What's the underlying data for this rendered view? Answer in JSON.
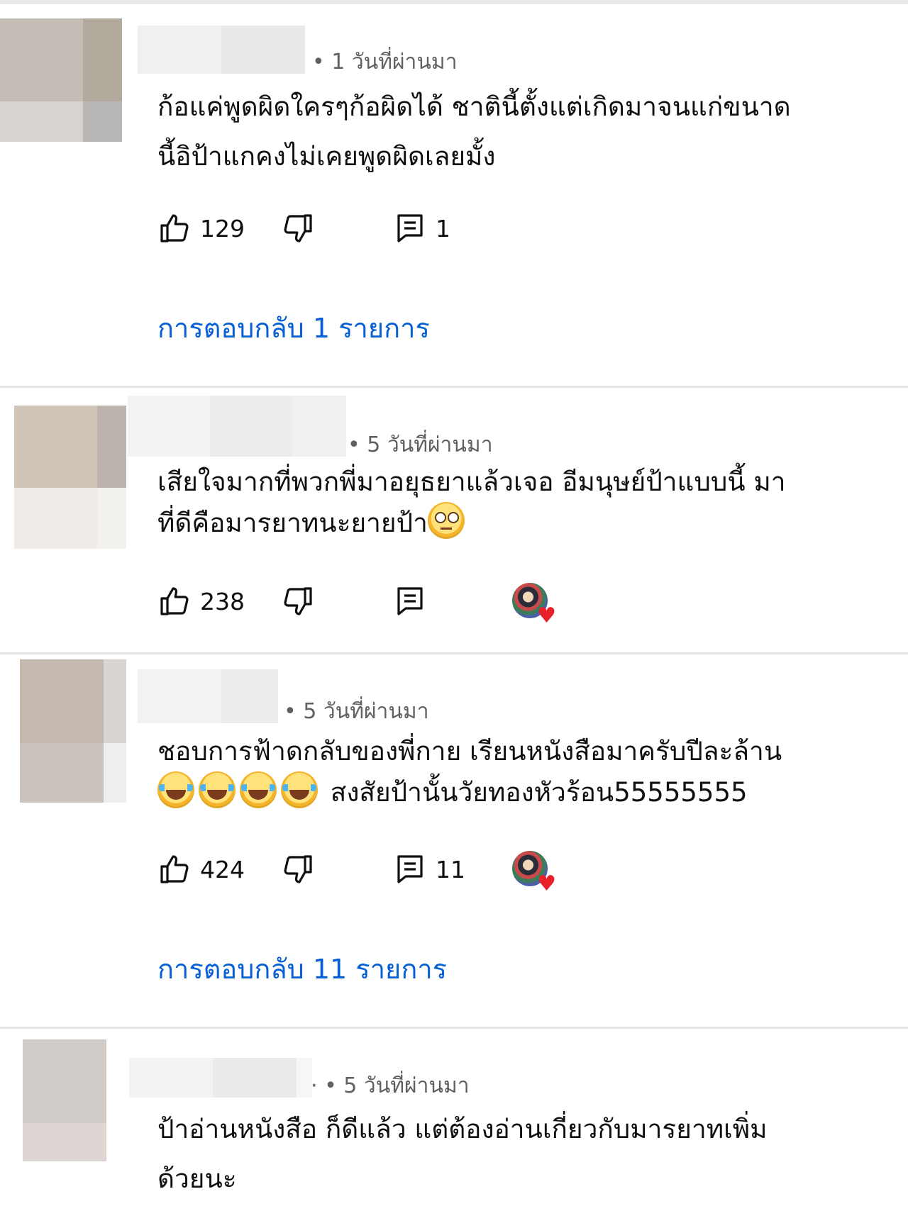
{
  "comments": [
    {
      "time": "• 1 วันที่ผ่านมา",
      "text_lines": [
        "ก้อแค่พูดผิดใครๆก้อผิดได้ ชาตินี้ตั้งแต่เกิดมาจนแก่ขนาด",
        "นี้อิป้าแกคงไม่เคยพูดผิดเลยมั้ง"
      ],
      "likes": "129",
      "reply_count": "1",
      "replies_link": "การตอบกลับ 1 รายการ"
    },
    {
      "time": "• 5 วันที่ผ่านมา",
      "text_lines": [
        "เสียใจมากที่พวกพี่มาอยุธยาแล้วเจอ อีมนุษย์ป้าแบบนี้  มา",
        "ที่ดีคือมารยาทนะยายป้า"
      ],
      "likes": "238",
      "reply_count": "",
      "emoji": "eyeroll-emoji",
      "creator_heart": "heart-icon"
    },
    {
      "time": "• 5 วันที่ผ่านมา",
      "text_lines": [
        "ชอบการฟ้าดกลับของพี่กาย เรียนหนังสือมาครับปีละล้าน",
        "สงสัยป้านั้นวัยทองหัวร้อน55555555"
      ],
      "likes": "424",
      "reply_count": "11",
      "emoji": "laughing-emoji",
      "creator_heart": "heart-icon",
      "replies_link": "การตอบกลับ 11 รายการ"
    },
    {
      "time": "· • 5 วันที่ผ่านมา",
      "text_lines": [
        "ป้าอ่านหนังสือ ก็ดีแล้ว แต่ต้องอ่านเกี่ยวกับมารยาทเพิ่ม",
        "ด้วยนะ"
      ]
    }
  ],
  "icons": {
    "like": "thumbs-up-icon",
    "dislike": "thumbs-down-icon",
    "reply": "reply-icon",
    "heart": "♥"
  },
  "colors": {
    "link": "#065fd4",
    "meta": "#606060",
    "divider": "#e3e3e3"
  }
}
